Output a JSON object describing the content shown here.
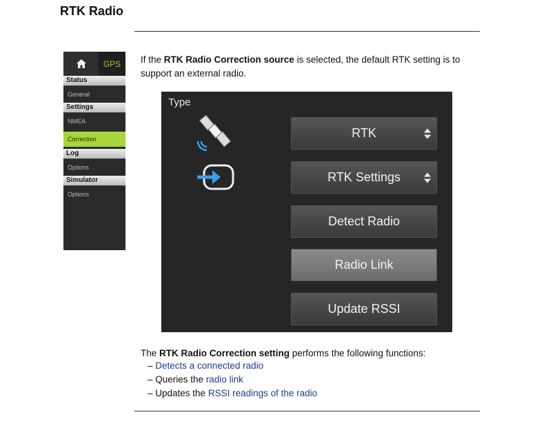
{
  "heading": "RTK Radio",
  "sidebar": {
    "gps_tab": "GPS",
    "sections": [
      {
        "title": "Status",
        "items": [
          "General"
        ]
      },
      {
        "title": "Settings",
        "items": [
          "NMEA",
          "Correction"
        ]
      },
      {
        "title": "Log",
        "items": [
          "Options"
        ]
      },
      {
        "title": "Simulator",
        "items": [
          "Options"
        ]
      }
    ]
  },
  "intro": {
    "pre": "If the ",
    "bold": "RTK Radio Correction source",
    "post": " is selected, the default RTK setting is to support an external radio."
  },
  "device": {
    "type_label": "Type",
    "buttons": {
      "rtk": "RTK",
      "rtk_settings": "RTK Settings",
      "detect_radio": "Detect Radio",
      "radio_link": "Radio Link",
      "update_rssi": "Update RSSI"
    }
  },
  "functions": {
    "pre": "The ",
    "bold": "RTK Radio Correction setting",
    "post": " performs the following functions:",
    "items": [
      {
        "dash": "– ",
        "plain": "",
        "link": "Detects a connected radio"
      },
      {
        "dash": "– ",
        "plain": "Queries the ",
        "link": "radio link"
      },
      {
        "dash": "– ",
        "plain": "Updates the ",
        "link": "RSSI readings of the radio"
      }
    ]
  },
  "colors": {
    "accent_green": "#a8d43c",
    "link_blue": "#1a3d8f"
  }
}
